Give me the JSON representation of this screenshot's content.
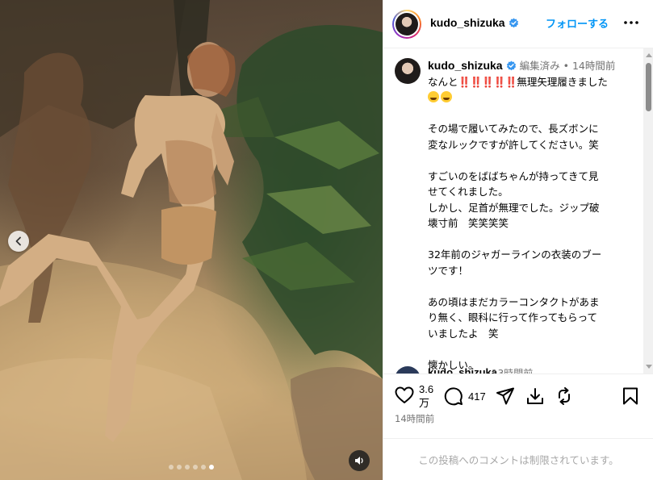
{
  "post": {
    "slide_count": 6,
    "active_slide": 6
  },
  "header": {
    "username": "kudo_shizuka",
    "follow_label": "フォローする"
  },
  "caption": {
    "username": "kudo_shizuka",
    "edited": "編集済み",
    "separator": "•",
    "time": "14時間前",
    "line1_prefix": "なんと",
    "line1_marks": "‼️‼️‼️‼️‼️",
    "line1_suffix": "無理矢理履きました",
    "line2": "その場で履いてみたので、長ズボンに",
    "line3": "変なルックですが許してください。笑",
    "line4": "すごいのをばばちゃんが持ってきて見",
    "line5": "せてくれました。",
    "line6": "しかし、足首が無理でした。ジップ破",
    "line7": "壊寸前　笑笑笑笑",
    "line8": "32年前のジャガーラインの衣装のブー",
    "line9": "ツです！",
    "line10": "あの頃はまだカラーコンタクトがあま",
    "line11": "り無く、眼科に行って作ってもらって",
    "line12": "いましたよ　笑",
    "line13": "懐かしい。"
  },
  "next_comment": {
    "username": "kudo_shizuka",
    "time": "13時間前"
  },
  "actions": {
    "likes_line1": "3.6",
    "likes_line2": "万",
    "comments": "417",
    "time_ago": "14時間前"
  },
  "comment_bar": {
    "notice": "この投稿へのコメントは制限されています。"
  },
  "colors": {
    "accent": "#0095f6",
    "verified": "#3897f0",
    "muted": "#737373"
  },
  "icons": [
    "chevron-left-icon",
    "speaker-icon",
    "verified-icon",
    "more-icon",
    "heart-icon",
    "comment-icon",
    "share-icon",
    "download-icon",
    "repost-icon",
    "bookmark-icon"
  ]
}
